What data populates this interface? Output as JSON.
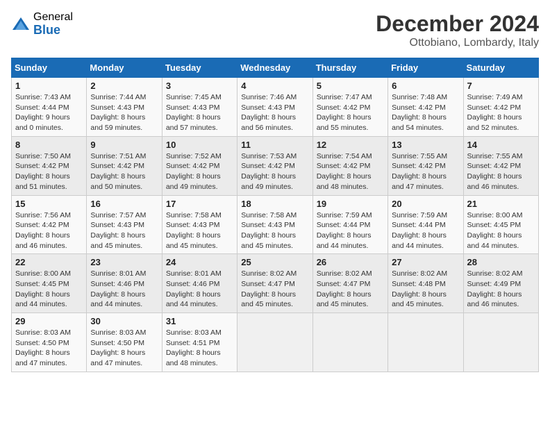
{
  "logo": {
    "general": "General",
    "blue": "Blue"
  },
  "title": {
    "month": "December 2024",
    "location": "Ottobiano, Lombardy, Italy"
  },
  "days_of_week": [
    "Sunday",
    "Monday",
    "Tuesday",
    "Wednesday",
    "Thursday",
    "Friday",
    "Saturday"
  ],
  "weeks": [
    [
      {
        "day": "1",
        "sunrise": "7:43 AM",
        "sunset": "4:44 PM",
        "daylight": "9 hours and 0 minutes."
      },
      {
        "day": "2",
        "sunrise": "7:44 AM",
        "sunset": "4:43 PM",
        "daylight": "8 hours and 59 minutes."
      },
      {
        "day": "3",
        "sunrise": "7:45 AM",
        "sunset": "4:43 PM",
        "daylight": "8 hours and 57 minutes."
      },
      {
        "day": "4",
        "sunrise": "7:46 AM",
        "sunset": "4:43 PM",
        "daylight": "8 hours and 56 minutes."
      },
      {
        "day": "5",
        "sunrise": "7:47 AM",
        "sunset": "4:42 PM",
        "daylight": "8 hours and 55 minutes."
      },
      {
        "day": "6",
        "sunrise": "7:48 AM",
        "sunset": "4:42 PM",
        "daylight": "8 hours and 54 minutes."
      },
      {
        "day": "7",
        "sunrise": "7:49 AM",
        "sunset": "4:42 PM",
        "daylight": "8 hours and 52 minutes."
      }
    ],
    [
      {
        "day": "8",
        "sunrise": "7:50 AM",
        "sunset": "4:42 PM",
        "daylight": "8 hours and 51 minutes."
      },
      {
        "day": "9",
        "sunrise": "7:51 AM",
        "sunset": "4:42 PM",
        "daylight": "8 hours and 50 minutes."
      },
      {
        "day": "10",
        "sunrise": "7:52 AM",
        "sunset": "4:42 PM",
        "daylight": "8 hours and 49 minutes."
      },
      {
        "day": "11",
        "sunrise": "7:53 AM",
        "sunset": "4:42 PM",
        "daylight": "8 hours and 49 minutes."
      },
      {
        "day": "12",
        "sunrise": "7:54 AM",
        "sunset": "4:42 PM",
        "daylight": "8 hours and 48 minutes."
      },
      {
        "day": "13",
        "sunrise": "7:55 AM",
        "sunset": "4:42 PM",
        "daylight": "8 hours and 47 minutes."
      },
      {
        "day": "14",
        "sunrise": "7:55 AM",
        "sunset": "4:42 PM",
        "daylight": "8 hours and 46 minutes."
      }
    ],
    [
      {
        "day": "15",
        "sunrise": "7:56 AM",
        "sunset": "4:42 PM",
        "daylight": "8 hours and 46 minutes."
      },
      {
        "day": "16",
        "sunrise": "7:57 AM",
        "sunset": "4:43 PM",
        "daylight": "8 hours and 45 minutes."
      },
      {
        "day": "17",
        "sunrise": "7:58 AM",
        "sunset": "4:43 PM",
        "daylight": "8 hours and 45 minutes."
      },
      {
        "day": "18",
        "sunrise": "7:58 AM",
        "sunset": "4:43 PM",
        "daylight": "8 hours and 45 minutes."
      },
      {
        "day": "19",
        "sunrise": "7:59 AM",
        "sunset": "4:44 PM",
        "daylight": "8 hours and 44 minutes."
      },
      {
        "day": "20",
        "sunrise": "7:59 AM",
        "sunset": "4:44 PM",
        "daylight": "8 hours and 44 minutes."
      },
      {
        "day": "21",
        "sunrise": "8:00 AM",
        "sunset": "4:45 PM",
        "daylight": "8 hours and 44 minutes."
      }
    ],
    [
      {
        "day": "22",
        "sunrise": "8:00 AM",
        "sunset": "4:45 PM",
        "daylight": "8 hours and 44 minutes."
      },
      {
        "day": "23",
        "sunrise": "8:01 AM",
        "sunset": "4:46 PM",
        "daylight": "8 hours and 44 minutes."
      },
      {
        "day": "24",
        "sunrise": "8:01 AM",
        "sunset": "4:46 PM",
        "daylight": "8 hours and 44 minutes."
      },
      {
        "day": "25",
        "sunrise": "8:02 AM",
        "sunset": "4:47 PM",
        "daylight": "8 hours and 45 minutes."
      },
      {
        "day": "26",
        "sunrise": "8:02 AM",
        "sunset": "4:47 PM",
        "daylight": "8 hours and 45 minutes."
      },
      {
        "day": "27",
        "sunrise": "8:02 AM",
        "sunset": "4:48 PM",
        "daylight": "8 hours and 45 minutes."
      },
      {
        "day": "28",
        "sunrise": "8:02 AM",
        "sunset": "4:49 PM",
        "daylight": "8 hours and 46 minutes."
      }
    ],
    [
      {
        "day": "29",
        "sunrise": "8:03 AM",
        "sunset": "4:50 PM",
        "daylight": "8 hours and 47 minutes."
      },
      {
        "day": "30",
        "sunrise": "8:03 AM",
        "sunset": "4:50 PM",
        "daylight": "8 hours and 47 minutes."
      },
      {
        "day": "31",
        "sunrise": "8:03 AM",
        "sunset": "4:51 PM",
        "daylight": "8 hours and 48 minutes."
      },
      null,
      null,
      null,
      null
    ]
  ],
  "labels": {
    "sunrise": "Sunrise:",
    "sunset": "Sunset:",
    "daylight": "Daylight:"
  }
}
